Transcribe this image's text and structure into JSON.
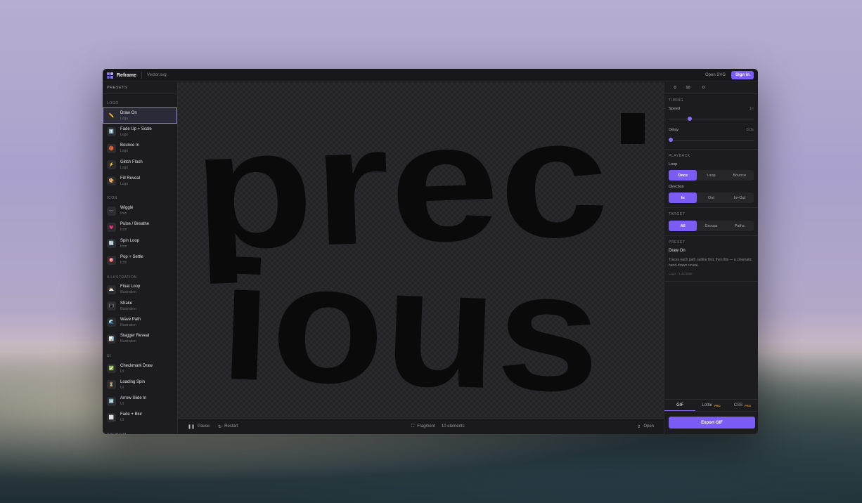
{
  "app": {
    "name": "Reframe",
    "file": "Vector.svg",
    "open_svg": "Open SVG",
    "sign_in": "Sign in"
  },
  "sidebar": {
    "header": "PRESETS",
    "groups": [
      {
        "title": "LOGO",
        "items": [
          {
            "name": "Draw On",
            "category": "Logo",
            "icon": "pencil-icon",
            "glyph": "✏️"
          },
          {
            "name": "Fade Up + Scale",
            "category": "Logo",
            "icon": "arrow-up-icon",
            "glyph": "⬆️"
          },
          {
            "name": "Bounce In",
            "category": "Logo",
            "icon": "ball-icon",
            "glyph": "🏀"
          },
          {
            "name": "Glitch Flash",
            "category": "Logo",
            "icon": "lightning-icon",
            "glyph": "⚡"
          },
          {
            "name": "Fill Reveal",
            "category": "Logo",
            "icon": "paint-icon",
            "glyph": "🎨"
          }
        ]
      },
      {
        "title": "ICON",
        "items": [
          {
            "name": "Wiggle",
            "category": "Icon",
            "icon": "wave-icon",
            "glyph": "〰️"
          },
          {
            "name": "Pulse / Breathe",
            "category": "Icon",
            "icon": "heart-icon",
            "glyph": "💗"
          },
          {
            "name": "Spin Loop",
            "category": "Icon",
            "icon": "cycle-icon",
            "glyph": "🔄"
          },
          {
            "name": "Pop + Settle",
            "category": "Icon",
            "icon": "target-icon",
            "glyph": "🎯"
          }
        ]
      },
      {
        "title": "ILLUSTRATION",
        "items": [
          {
            "name": "Float Loop",
            "category": "Illustration",
            "icon": "cloud-icon",
            "glyph": "🌥️"
          },
          {
            "name": "Shake",
            "category": "Illustration",
            "icon": "vibrate-icon",
            "glyph": "📳"
          },
          {
            "name": "Wave Path",
            "category": "Illustration",
            "icon": "ocean-icon",
            "glyph": "🌊"
          },
          {
            "name": "Stagger Reveal",
            "category": "Illustration",
            "icon": "chart-icon",
            "glyph": "📊"
          }
        ]
      },
      {
        "title": "UI",
        "items": [
          {
            "name": "Checkmark Draw",
            "category": "UI",
            "icon": "checkmark-icon",
            "glyph": "✅"
          },
          {
            "name": "Loading Spin",
            "category": "UI",
            "icon": "hourglass-icon",
            "glyph": "⏳"
          },
          {
            "name": "Arrow Slide In",
            "category": "UI",
            "icon": "arrow-right-icon",
            "glyph": "➡️"
          },
          {
            "name": "Fade + Blur",
            "category": "UI",
            "icon": "blur-icon",
            "glyph": "⬜"
          }
        ]
      }
    ],
    "premium_title": "PREMIUM"
  },
  "canvas": {
    "line1": "prec",
    "line2": "ious"
  },
  "bottombar": {
    "pause": "Pause",
    "restart": "Restart",
    "fragment": "Fragment",
    "elements": "10 elements",
    "open": "Open"
  },
  "panel": {
    "coords": {
      "x": "0",
      "y": "10",
      "z": "0"
    },
    "timing": {
      "title": "TIMING",
      "speed_label": "Speed",
      "speed_value": "1×",
      "speed_level": 0.25,
      "delay_label": "Delay",
      "delay_value": "0.0s",
      "delay_level": 0.0
    },
    "playback": {
      "title": "PLAYBACK",
      "loop_label": "Loop",
      "loop_options": [
        "Once",
        "Loop",
        "Bounce"
      ],
      "loop_selected": "Once",
      "direction_label": "Direction",
      "direction_options": [
        "In",
        "Out",
        "In+Out"
      ],
      "direction_selected": "In"
    },
    "target": {
      "title": "TARGET",
      "options": [
        "All",
        "Groups",
        "Paths"
      ],
      "selected": "All"
    },
    "preset": {
      "title": "PRESET",
      "name": "Draw On",
      "description": "Traces each path outline first, then fills — a cinematic hand-drawn reveal.",
      "meta": "Logo · 1.4s base"
    },
    "export": {
      "tabs": [
        "GIF",
        "Lottie",
        "CSS"
      ],
      "pro_label": "PRO",
      "selected": "GIF",
      "button": "Export GIF"
    }
  },
  "colors": {
    "accent": "#7b5cf5",
    "pro": "#e5932a",
    "bg": "#1b1b1d"
  }
}
